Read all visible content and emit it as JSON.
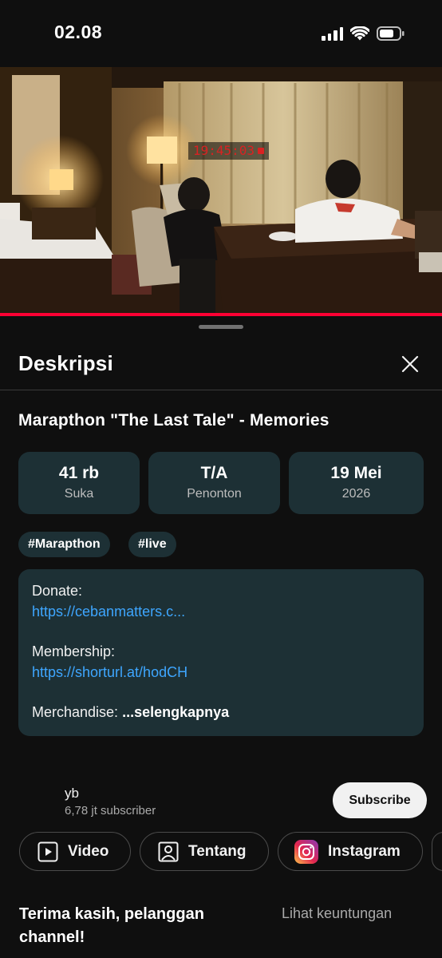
{
  "status_bar": {
    "time": "02.08",
    "signal_icon": "signal-icon",
    "wifi_icon": "wifi-icon",
    "battery_icon": "battery-icon"
  },
  "video": {
    "timestamp": "19:45:03",
    "progress": 1.0,
    "accent_color": "#ff0033"
  },
  "description_panel": {
    "title": "Deskripsi",
    "close_icon": "close-icon",
    "video_title": "Marapthon \"The Last Tale\" - Memories",
    "stats": [
      {
        "value": "41 rb",
        "label": "Suka"
      },
      {
        "value": "T/A",
        "label": "Penonton"
      },
      {
        "value": "19 Mei",
        "label": "2026"
      }
    ],
    "tags": [
      "#Marapthon",
      "#live"
    ],
    "description": {
      "donate_label": "Donate:",
      "donate_link": "https://cebanmatters.c...",
      "membership_label": "Membership:",
      "membership_link": "https://shorturl.at/hodCH",
      "merch_label": "Merchandise:",
      "more_label": "...selengkapnya"
    },
    "link_color": "#3ea6ff",
    "card_color": "#1d3035"
  },
  "channel": {
    "name": "yb",
    "subscribers": "6,78 jt subscriber",
    "subscribe_label": "Subscribe",
    "chips": [
      {
        "label": "Video",
        "icon": "video-icon"
      },
      {
        "label": "Tentang",
        "icon": "profile-icon"
      },
      {
        "label": "Instagram",
        "icon": "instagram-icon"
      }
    ]
  },
  "membership": {
    "thanks_text": "Terima kasih, pelanggan channel!",
    "benefits_link": "Lihat keuntungan"
  }
}
